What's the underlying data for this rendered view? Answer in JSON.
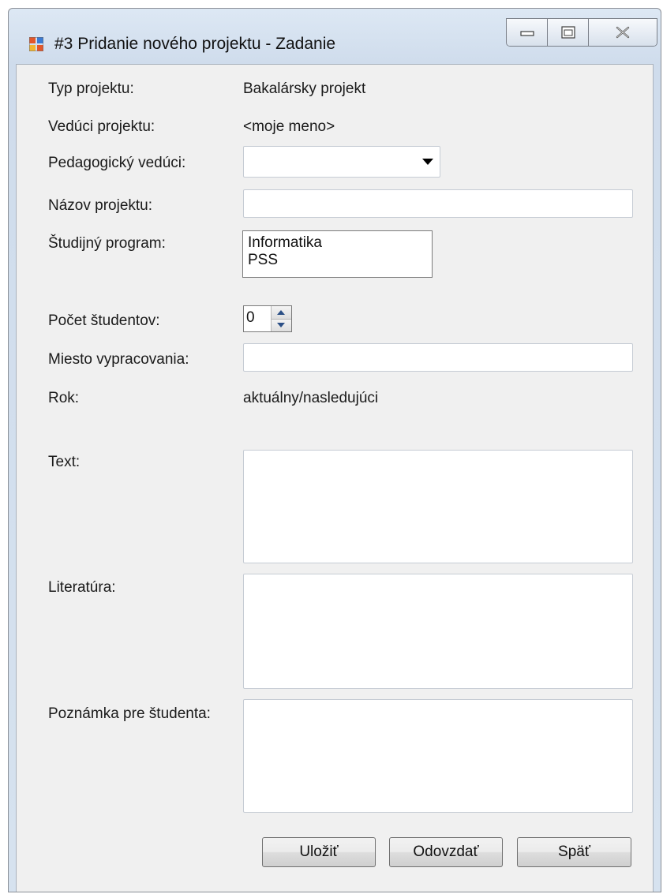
{
  "window": {
    "title": "#3 Pridanie nového projektu - Zadanie",
    "controls": {
      "minimize": "minimize-icon",
      "maximize": "maximize-icon",
      "close": "close-icon"
    }
  },
  "form": {
    "typ_projektu": {
      "label": "Typ projektu:",
      "value": "Bakalársky projekt"
    },
    "veduci_projektu": {
      "label": "Vedúci projektu:",
      "value": "<moje meno>"
    },
    "pedagogicky_veduci": {
      "label": "Pedagogický vedúci:",
      "value": ""
    },
    "nazov_projektu": {
      "label": "Názov projektu:",
      "value": ""
    },
    "studijny_program": {
      "label": "Študijný program:",
      "options": [
        "Informatika",
        "PSS"
      ]
    },
    "pocet_studentov": {
      "label": "Počet študentov:",
      "value": "0"
    },
    "miesto_vypracovania": {
      "label": "Miesto vypracovania:",
      "value": ""
    },
    "rok": {
      "label": "Rok:",
      "value": "aktuálny/nasledujúci"
    },
    "text": {
      "label": "Text:",
      "value": ""
    },
    "literatura": {
      "label": "Literatúra:",
      "value": ""
    },
    "poznamka": {
      "label": "Poznámka pre študenta:",
      "value": ""
    }
  },
  "buttons": {
    "ulozit": "Uložiť",
    "odovzdat": "Odovzdať",
    "spat": "Späť"
  },
  "colors": {
    "frame": "#cfdcec",
    "client": "#f0f0f0",
    "input_border": "#c6ccd4"
  }
}
